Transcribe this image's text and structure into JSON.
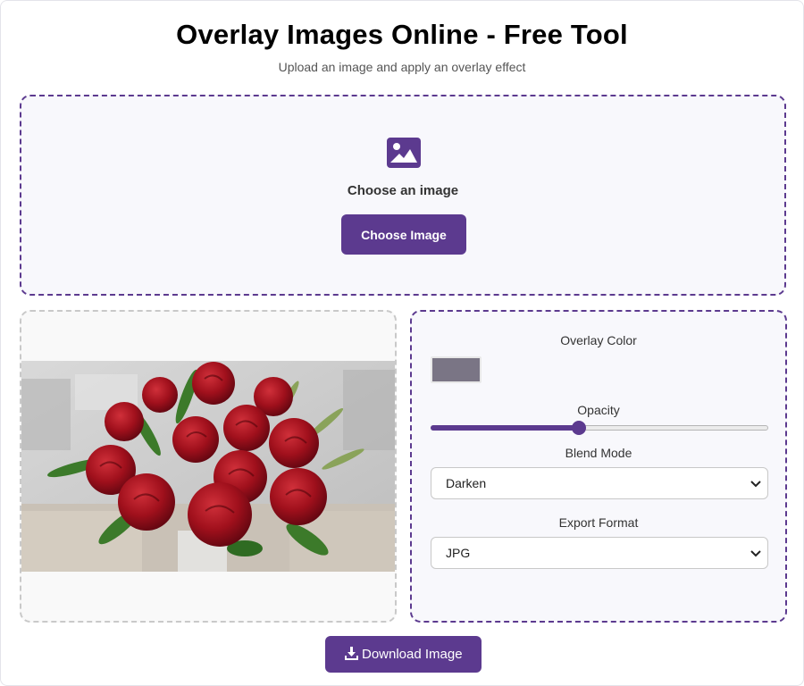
{
  "header": {
    "title": "Overlay Images Online - Free Tool",
    "subtitle": "Upload an image and apply an overlay effect"
  },
  "upload": {
    "icon": "image-icon",
    "label": "Choose an image",
    "button_label": "Choose Image"
  },
  "preview": {
    "image": "preview-image-red-roses"
  },
  "controls": {
    "overlay_color_label": "Overlay Color",
    "overlay_color_value": "#7a7585",
    "opacity_label": "Opacity",
    "opacity_value": 0.44,
    "blend_mode_label": "Blend Mode",
    "blend_mode_value": "Darken",
    "export_format_label": "Export Format",
    "export_format_value": "JPG"
  },
  "download": {
    "icon": "download-icon",
    "label": "Download Image"
  },
  "colors": {
    "accent": "#5c3a8f",
    "upload_bg": "#f8f8fc",
    "preview_border": "#c9c9c9"
  }
}
